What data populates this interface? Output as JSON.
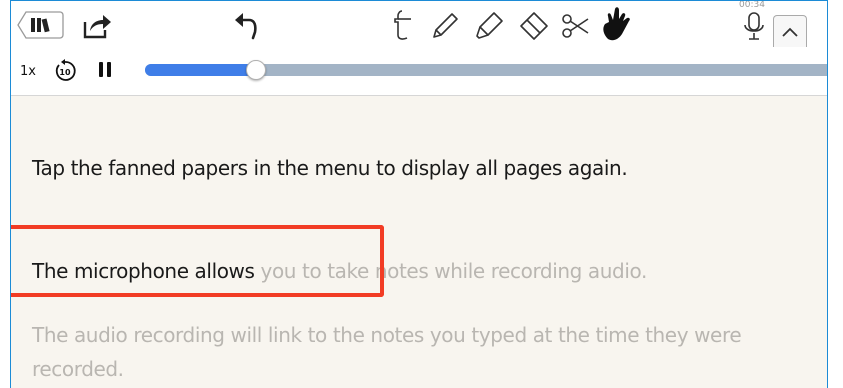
{
  "toolbar": {
    "icons": [
      "library-icon",
      "share-icon",
      "undo-icon",
      "text-tool-icon",
      "pen-icon",
      "highlighter-icon",
      "eraser-icon",
      "scissors-icon",
      "hand-icon",
      "microphone-icon",
      "chevron-up-icon"
    ],
    "timer": "00:34"
  },
  "audio": {
    "speed_label": "1x",
    "skip_back_label": "10",
    "progress": 0.158,
    "accent_color": "#3f7ee8",
    "track_color": "#a3b4c6"
  },
  "content": {
    "line1": "Tap the fanned papers in the menu to display all pages again.",
    "line2_dark": "The microphone allows",
    "line2_faded": " you to take notes while recording audio.",
    "line3": "The audio recording will link to the notes you typed at the time they were",
    "line4": "recorded."
  },
  "colors": {
    "highlight_box": "#f23c24",
    "paper": "#f8f5ef",
    "frame": "#1c8bd6",
    "faded_text": "#b9b6b1"
  }
}
